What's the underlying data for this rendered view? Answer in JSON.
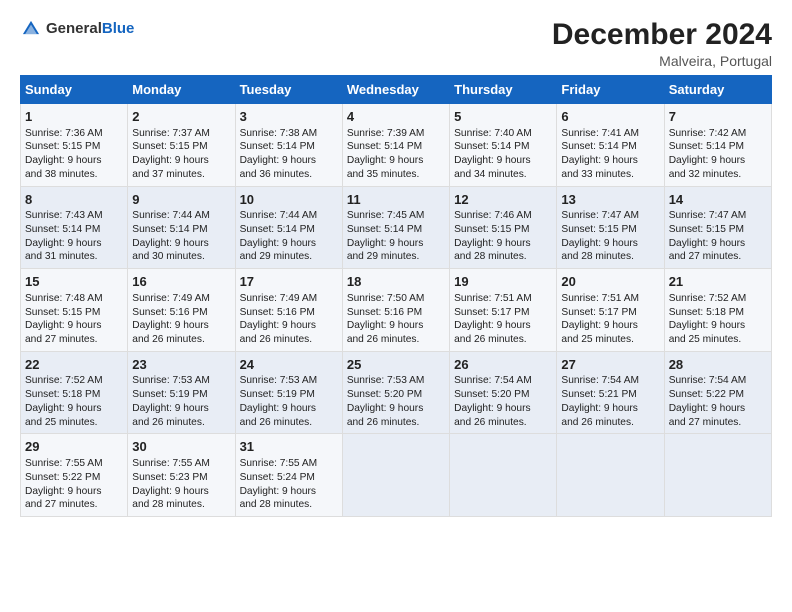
{
  "logo": {
    "general": "General",
    "blue": "Blue"
  },
  "title": "December 2024",
  "subtitle": "Malveira, Portugal",
  "days_of_week": [
    "Sunday",
    "Monday",
    "Tuesday",
    "Wednesday",
    "Thursday",
    "Friday",
    "Saturday"
  ],
  "weeks": [
    [
      {
        "day": "1",
        "lines": [
          "Sunrise: 7:36 AM",
          "Sunset: 5:15 PM",
          "Daylight: 9 hours",
          "and 38 minutes."
        ]
      },
      {
        "day": "2",
        "lines": [
          "Sunrise: 7:37 AM",
          "Sunset: 5:15 PM",
          "Daylight: 9 hours",
          "and 37 minutes."
        ]
      },
      {
        "day": "3",
        "lines": [
          "Sunrise: 7:38 AM",
          "Sunset: 5:14 PM",
          "Daylight: 9 hours",
          "and 36 minutes."
        ]
      },
      {
        "day": "4",
        "lines": [
          "Sunrise: 7:39 AM",
          "Sunset: 5:14 PM",
          "Daylight: 9 hours",
          "and 35 minutes."
        ]
      },
      {
        "day": "5",
        "lines": [
          "Sunrise: 7:40 AM",
          "Sunset: 5:14 PM",
          "Daylight: 9 hours",
          "and 34 minutes."
        ]
      },
      {
        "day": "6",
        "lines": [
          "Sunrise: 7:41 AM",
          "Sunset: 5:14 PM",
          "Daylight: 9 hours",
          "and 33 minutes."
        ]
      },
      {
        "day": "7",
        "lines": [
          "Sunrise: 7:42 AM",
          "Sunset: 5:14 PM",
          "Daylight: 9 hours",
          "and 32 minutes."
        ]
      }
    ],
    [
      {
        "day": "8",
        "lines": [
          "Sunrise: 7:43 AM",
          "Sunset: 5:14 PM",
          "Daylight: 9 hours",
          "and 31 minutes."
        ]
      },
      {
        "day": "9",
        "lines": [
          "Sunrise: 7:44 AM",
          "Sunset: 5:14 PM",
          "Daylight: 9 hours",
          "and 30 minutes."
        ]
      },
      {
        "day": "10",
        "lines": [
          "Sunrise: 7:44 AM",
          "Sunset: 5:14 PM",
          "Daylight: 9 hours",
          "and 29 minutes."
        ]
      },
      {
        "day": "11",
        "lines": [
          "Sunrise: 7:45 AM",
          "Sunset: 5:14 PM",
          "Daylight: 9 hours",
          "and 29 minutes."
        ]
      },
      {
        "day": "12",
        "lines": [
          "Sunrise: 7:46 AM",
          "Sunset: 5:15 PM",
          "Daylight: 9 hours",
          "and 28 minutes."
        ]
      },
      {
        "day": "13",
        "lines": [
          "Sunrise: 7:47 AM",
          "Sunset: 5:15 PM",
          "Daylight: 9 hours",
          "and 28 minutes."
        ]
      },
      {
        "day": "14",
        "lines": [
          "Sunrise: 7:47 AM",
          "Sunset: 5:15 PM",
          "Daylight: 9 hours",
          "and 27 minutes."
        ]
      }
    ],
    [
      {
        "day": "15",
        "lines": [
          "Sunrise: 7:48 AM",
          "Sunset: 5:15 PM",
          "Daylight: 9 hours",
          "and 27 minutes."
        ]
      },
      {
        "day": "16",
        "lines": [
          "Sunrise: 7:49 AM",
          "Sunset: 5:16 PM",
          "Daylight: 9 hours",
          "and 26 minutes."
        ]
      },
      {
        "day": "17",
        "lines": [
          "Sunrise: 7:49 AM",
          "Sunset: 5:16 PM",
          "Daylight: 9 hours",
          "and 26 minutes."
        ]
      },
      {
        "day": "18",
        "lines": [
          "Sunrise: 7:50 AM",
          "Sunset: 5:16 PM",
          "Daylight: 9 hours",
          "and 26 minutes."
        ]
      },
      {
        "day": "19",
        "lines": [
          "Sunrise: 7:51 AM",
          "Sunset: 5:17 PM",
          "Daylight: 9 hours",
          "and 26 minutes."
        ]
      },
      {
        "day": "20",
        "lines": [
          "Sunrise: 7:51 AM",
          "Sunset: 5:17 PM",
          "Daylight: 9 hours",
          "and 25 minutes."
        ]
      },
      {
        "day": "21",
        "lines": [
          "Sunrise: 7:52 AM",
          "Sunset: 5:18 PM",
          "Daylight: 9 hours",
          "and 25 minutes."
        ]
      }
    ],
    [
      {
        "day": "22",
        "lines": [
          "Sunrise: 7:52 AM",
          "Sunset: 5:18 PM",
          "Daylight: 9 hours",
          "and 25 minutes."
        ]
      },
      {
        "day": "23",
        "lines": [
          "Sunrise: 7:53 AM",
          "Sunset: 5:19 PM",
          "Daylight: 9 hours",
          "and 26 minutes."
        ]
      },
      {
        "day": "24",
        "lines": [
          "Sunrise: 7:53 AM",
          "Sunset: 5:19 PM",
          "Daylight: 9 hours",
          "and 26 minutes."
        ]
      },
      {
        "day": "25",
        "lines": [
          "Sunrise: 7:53 AM",
          "Sunset: 5:20 PM",
          "Daylight: 9 hours",
          "and 26 minutes."
        ]
      },
      {
        "day": "26",
        "lines": [
          "Sunrise: 7:54 AM",
          "Sunset: 5:20 PM",
          "Daylight: 9 hours",
          "and 26 minutes."
        ]
      },
      {
        "day": "27",
        "lines": [
          "Sunrise: 7:54 AM",
          "Sunset: 5:21 PM",
          "Daylight: 9 hours",
          "and 26 minutes."
        ]
      },
      {
        "day": "28",
        "lines": [
          "Sunrise: 7:54 AM",
          "Sunset: 5:22 PM",
          "Daylight: 9 hours",
          "and 27 minutes."
        ]
      }
    ],
    [
      {
        "day": "29",
        "lines": [
          "Sunrise: 7:55 AM",
          "Sunset: 5:22 PM",
          "Daylight: 9 hours",
          "and 27 minutes."
        ]
      },
      {
        "day": "30",
        "lines": [
          "Sunrise: 7:55 AM",
          "Sunset: 5:23 PM",
          "Daylight: 9 hours",
          "and 28 minutes."
        ]
      },
      {
        "day": "31",
        "lines": [
          "Sunrise: 7:55 AM",
          "Sunset: 5:24 PM",
          "Daylight: 9 hours",
          "and 28 minutes."
        ]
      },
      null,
      null,
      null,
      null
    ]
  ]
}
